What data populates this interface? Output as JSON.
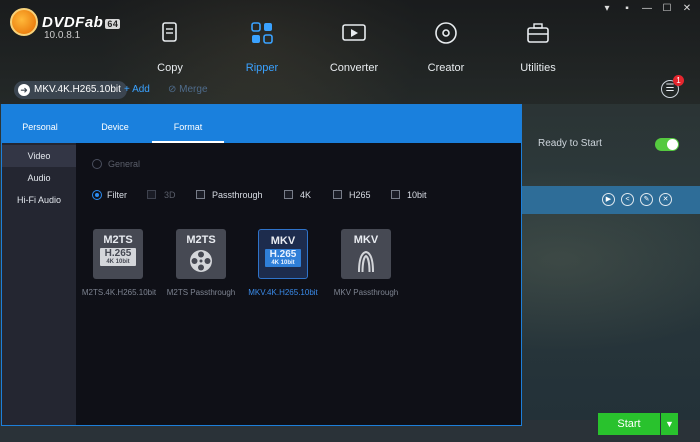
{
  "app": {
    "name": "DVDFab",
    "edition_badge": "64",
    "version": "10.0.8.1"
  },
  "window_controls": [
    "▾",
    "▪",
    "—",
    "☐",
    "✕"
  ],
  "modules": [
    {
      "label": "Copy",
      "icon": "copy-icon"
    },
    {
      "label": "Ripper",
      "icon": "ripper-icon",
      "active": true
    },
    {
      "label": "Converter",
      "icon": "converter-icon"
    },
    {
      "label": "Creator",
      "icon": "creator-icon"
    },
    {
      "label": "Utilities",
      "icon": "utilities-icon"
    }
  ],
  "profile_bar": {
    "current_profile": "MKV.4K.H265.10bit",
    "add_label": "+ Add",
    "merge_label": "⊘ Merge",
    "task_badge": "1"
  },
  "main": {
    "ready_text": "Ready to Start",
    "auto_start_on": true,
    "start_label": "Start"
  },
  "panel": {
    "tabs": [
      {
        "label": "Personal"
      },
      {
        "label": "Device"
      },
      {
        "label": "Format",
        "selected": true
      }
    ],
    "sidebar": [
      {
        "label": "Video",
        "selected": true
      },
      {
        "label": "Audio"
      },
      {
        "label": "Hi-Fi Audio"
      }
    ],
    "mode_general": "General",
    "mode_filter": "Filter",
    "filters": [
      {
        "label": "3D",
        "disabled": true
      },
      {
        "label": "Passthrough"
      },
      {
        "label": "4K"
      },
      {
        "label": "H265"
      },
      {
        "label": "10bit"
      }
    ],
    "formats": [
      {
        "top": "M2TS",
        "codec": "H.265",
        "sub": "4K 10bit",
        "label": "M2TS.4K.H265.10bit"
      },
      {
        "top": "M2TS",
        "codec": "",
        "sub": "",
        "label": "M2TS Passthrough"
      },
      {
        "top": "MKV",
        "codec": "H.265",
        "sub": "4K 10bit",
        "label": "MKV.4K.H265.10bit",
        "selected": true
      },
      {
        "top": "MKV",
        "codec": "",
        "sub": "",
        "label": "MKV Passthrough"
      }
    ]
  },
  "colors": {
    "accent_blue": "#1a80dd",
    "start_green": "#29c22d",
    "toggle_green": "#55c93f"
  }
}
